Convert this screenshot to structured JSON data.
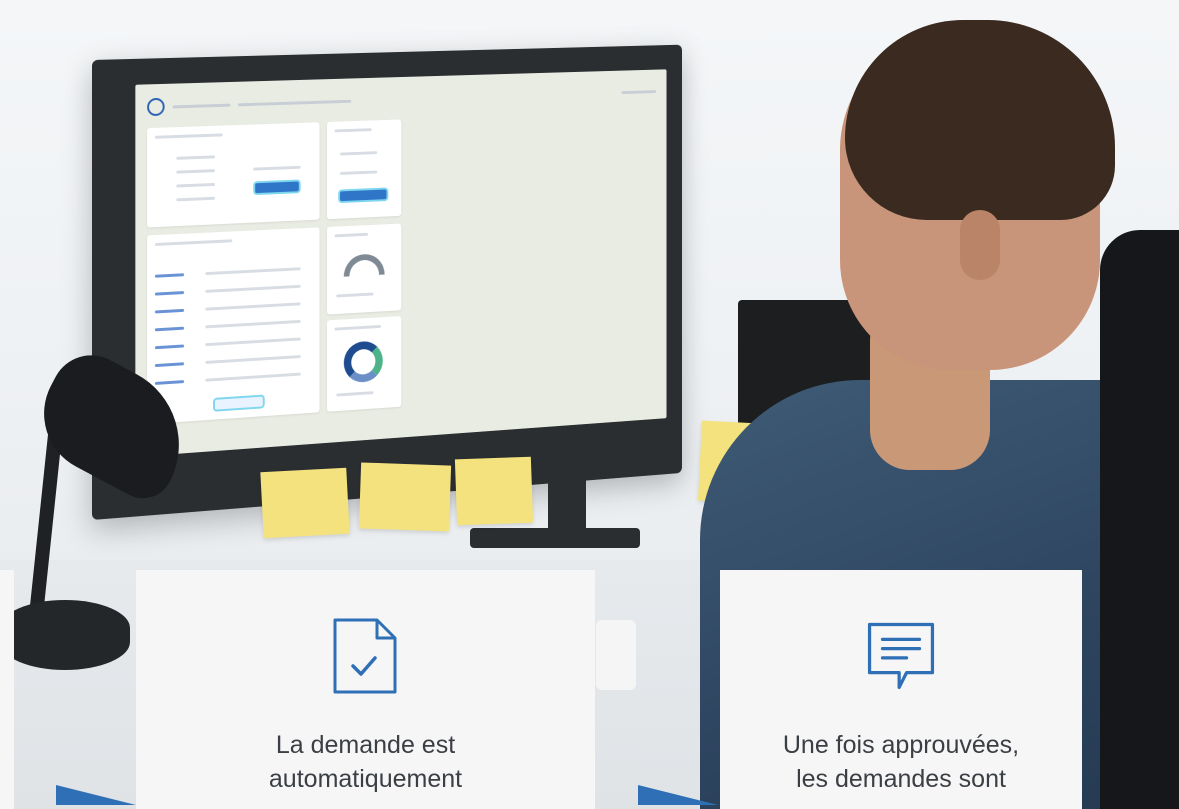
{
  "cards": [
    {
      "icon": "document-check-icon",
      "text": "La demande est\nautomatiquement"
    },
    {
      "icon": "chat-message-icon",
      "text": "Une fois approuvées,\nles demandes sont"
    }
  ],
  "colors": {
    "accent": "#2f6fb6",
    "card_bg": "#f6f6f6",
    "text": "#3b3f44"
  }
}
